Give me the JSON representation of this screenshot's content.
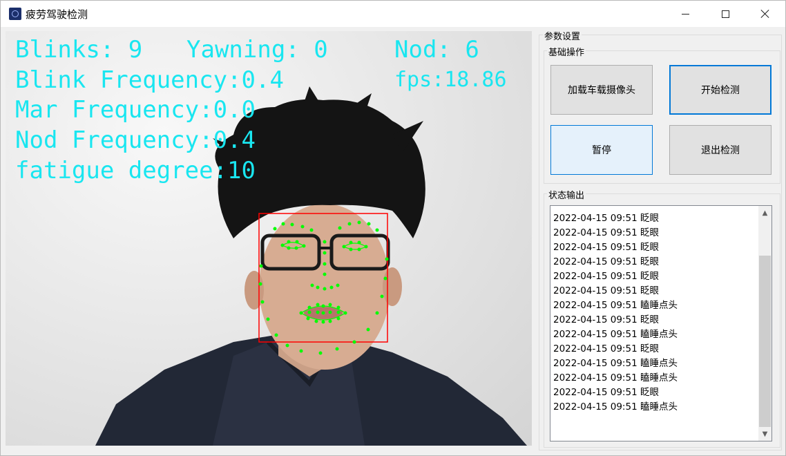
{
  "window": {
    "title": "疲劳驾驶检测",
    "icon": "app-logo-icon",
    "controls": [
      "minimize-icon",
      "maximize-icon",
      "close-icon"
    ]
  },
  "video": {
    "overlay": {
      "blinks": "Blinks: 9",
      "yawning": "Yawning: 0",
      "nod": "Nod: 6",
      "blink_frequency": "Blink Frequency:0.4",
      "fps": "fps:18.86",
      "mar_frequency": "Mar Frequency:0.0",
      "nod_frequency": "Nod Frequency:0.4",
      "fatigue_degree": "fatigue degree:10"
    },
    "overlay_color": "#19e6f0",
    "face_box_color": "#ff0000",
    "landmark_color": "#00ff00"
  },
  "settings": {
    "title": "参数设置",
    "basic_ops": {
      "title": "基础操作",
      "load_camera": "加载车载摄像头",
      "start_detect": "开始检测",
      "pause": "暂停",
      "exit_detect": "退出检测"
    },
    "status": {
      "title": "状态输出",
      "lines": [
        "2022-04-15 09:51 眨眼",
        "2022-04-15 09:51 眨眼",
        "2022-04-15 09:51 眨眼",
        "2022-04-15 09:51 眨眼",
        "2022-04-15 09:51 眨眼",
        "2022-04-15 09:51 眨眼",
        "2022-04-15 09:51 瞌睡点头",
        "2022-04-15 09:51 眨眼",
        "2022-04-15 09:51 瞌睡点头",
        "2022-04-15 09:51 眨眼",
        "2022-04-15 09:51 瞌睡点头",
        "2022-04-15 09:51 瞌睡点头",
        "2022-04-15 09:51 眨眼",
        "2022-04-15 09:51 瞌睡点头"
      ]
    }
  },
  "colors": {
    "accent": "#0078d7",
    "button_bg": "#e1e1e1",
    "hover_bg": "#e5f1fb"
  }
}
